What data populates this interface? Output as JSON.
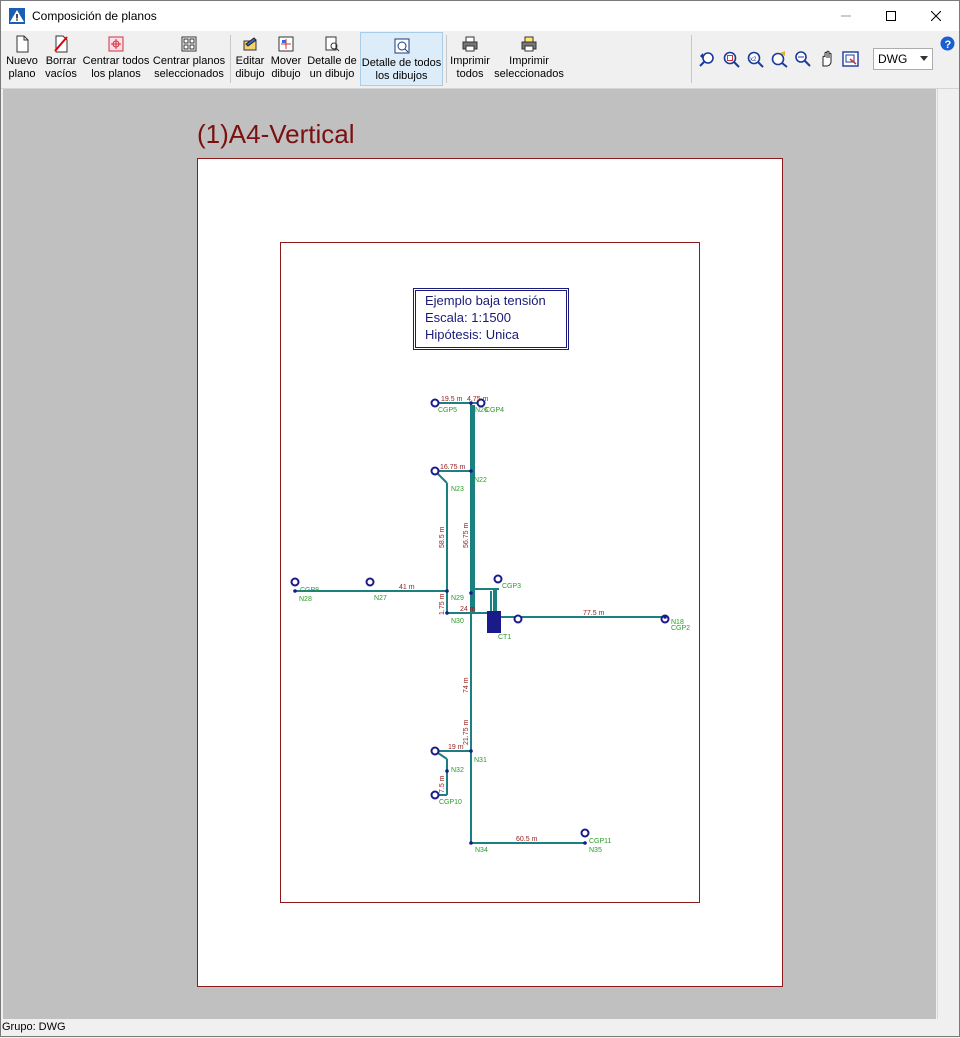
{
  "window": {
    "title": "Composición de planos"
  },
  "toolbar": {
    "nuevo_plano": "Nuevo\nplano",
    "borrar_vacios": "Borrar\nvacíos",
    "centrar_todos": "Centrar todos\nlos planos",
    "centrar_seleccionados": "Centrar planos\nseleccionados",
    "editar_dibujo": "Editar\ndibujo",
    "mover_dibujo": "Mover\ndibujo",
    "detalle_un_dibujo": "Detalle de\nun dibujo",
    "detalle_todos": "Detalle de todos\nlos dibujos",
    "imprimir_todos": "Imprimir\ntodos",
    "imprimir_seleccionados": "Imprimir\nseleccionados",
    "format_value": "DWG"
  },
  "sheet": {
    "title": "(1)A4-Vertical",
    "legend": {
      "line1": "Ejemplo baja tensión",
      "line2": "Escala: 1:1500",
      "line3": "Hipótesis: Unica"
    }
  },
  "drawing": {
    "nodes": {
      "cgp5": "CGP5",
      "n26": "N26",
      "cgp4": "CGP4",
      "n22": "N22",
      "n23": "N23",
      "cgp8": "CGP8",
      "n28": "N28",
      "n27": "N27",
      "n29": "N29",
      "n30": "N30",
      "cgp3": "CGP3",
      "ct1": "CT1",
      "n18": "N18",
      "cgp2": "CGP2",
      "n31": "N31",
      "n32": "N32",
      "cgp10": "CGP10",
      "n34": "N34",
      "cgp11": "CGP11",
      "n35": "N35"
    },
    "lengths": {
      "l1": "19.5 m",
      "l2": "4.75 m",
      "l3": "16.75 m",
      "l4": "58.5 m",
      "l5": "56.75 m",
      "l6": "41 m",
      "l7": "1.75 m",
      "l8": "24 m",
      "l9": "77.5 m",
      "l10": "74 m",
      "l11": "21.75 m",
      "l12": "19 m",
      "l13": "7.5 m",
      "l14": "60.5 m"
    }
  },
  "status": {
    "text": "Grupo: DWG"
  },
  "colors": {
    "frame": "#8b1a1a",
    "line": "#1a8080",
    "node": "#1a1a8a",
    "label": "#2a9a2a",
    "dim": "#9a1a1a"
  }
}
